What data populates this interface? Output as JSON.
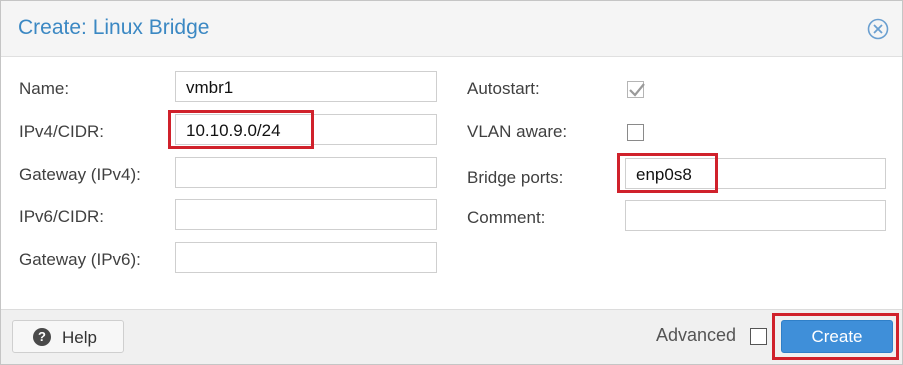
{
  "dialog": {
    "title": "Create: Linux Bridge",
    "close_icon": "close-circle-icon"
  },
  "left": {
    "name_label": "Name:",
    "name_value": "vmbr1",
    "ipv4_label": "IPv4/CIDR:",
    "ipv4_value": "10.10.9.0/24",
    "gateway4_label": "Gateway (IPv4):",
    "gateway4_value": "",
    "ipv6_label": "IPv6/CIDR:",
    "ipv6_value": "",
    "gateway6_label": "Gateway (IPv6):",
    "gateway6_value": ""
  },
  "right": {
    "autostart_label": "Autostart:",
    "autostart_checked": true,
    "vlan_label": "VLAN aware:",
    "vlan_checked": false,
    "ports_label": "Bridge ports:",
    "ports_value": "enp0s8",
    "comment_label": "Comment:",
    "comment_value": ""
  },
  "footer": {
    "help_label": "Help",
    "help_icon": "question-circle-icon",
    "advanced_label": "Advanced",
    "advanced_checked": false,
    "create_label": "Create"
  },
  "colors": {
    "title": "#3b88c3",
    "primary_button": "#3f8fd9",
    "highlight": "#d0212b"
  }
}
